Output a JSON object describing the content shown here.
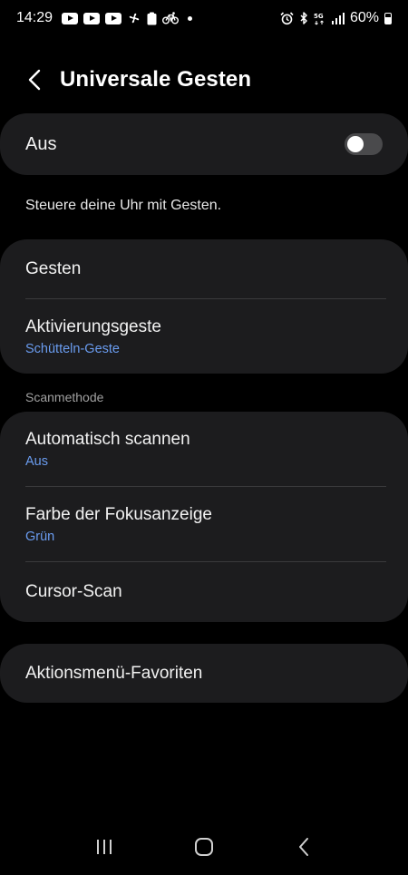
{
  "status_bar": {
    "time": "14:29",
    "battery_percent": "60%",
    "network": "5G",
    "icons_left": [
      "youtube-icon",
      "youtube-icon",
      "youtube-icon",
      "fan-icon",
      "clipboard-icon",
      "bicycle-icon",
      "notification-dot"
    ],
    "icons_right": [
      "alarm-icon",
      "bluetooth-icon",
      "5g-icon",
      "signal-icon",
      "battery-icon"
    ]
  },
  "header": {
    "title": "Universale Gesten"
  },
  "master_toggle": {
    "label": "Aus",
    "state": "off"
  },
  "description": "Steuere deine Uhr mit Gesten.",
  "gestures_card": {
    "items": [
      {
        "title": "Gesten"
      },
      {
        "title": "Aktivierungsgeste",
        "subtitle": "Schütteln-Geste"
      }
    ]
  },
  "scan_section": {
    "header": "Scanmethode",
    "items": [
      {
        "title": "Automatisch scannen",
        "subtitle": "Aus"
      },
      {
        "title": "Farbe der Fokusanzeige",
        "subtitle": "Grün"
      },
      {
        "title": "Cursor-Scan"
      }
    ]
  },
  "favorites_card": {
    "title": "Aktionsmenü-Favoriten"
  },
  "colors": {
    "background": "#000000",
    "card": "#1c1c1e",
    "accent_subtitle": "#6a9cf0",
    "toggle_off": "#4a4a4c"
  }
}
